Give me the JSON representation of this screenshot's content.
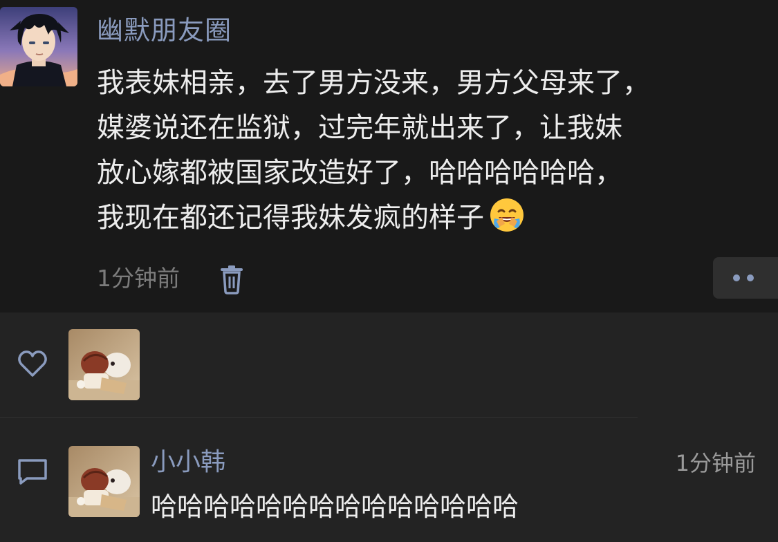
{
  "post": {
    "author": "幽默朋友圈",
    "lines": [
      "我表妹相亲，去了男方没来，男方父母来了，",
      "媒婆说还在监狱，过完年就出来了，让我妹",
      "放心嫁都被国家改造好了，哈哈哈哈哈哈，",
      "我现在都还记得我妹发疯的样子"
    ],
    "emoji": "laughing-crying-emoji",
    "time": "1分钟前",
    "icons": {
      "delete": "trash-icon",
      "more": "more-dots-icon"
    },
    "accent_color": "#8A9BBE"
  },
  "likes": {
    "icon": "heart-icon"
  },
  "comments": [
    {
      "icon": "comment-icon",
      "name": "小小韩",
      "time": "1分钟前",
      "text": "哈哈哈哈哈哈哈哈哈哈哈哈哈哈"
    }
  ]
}
